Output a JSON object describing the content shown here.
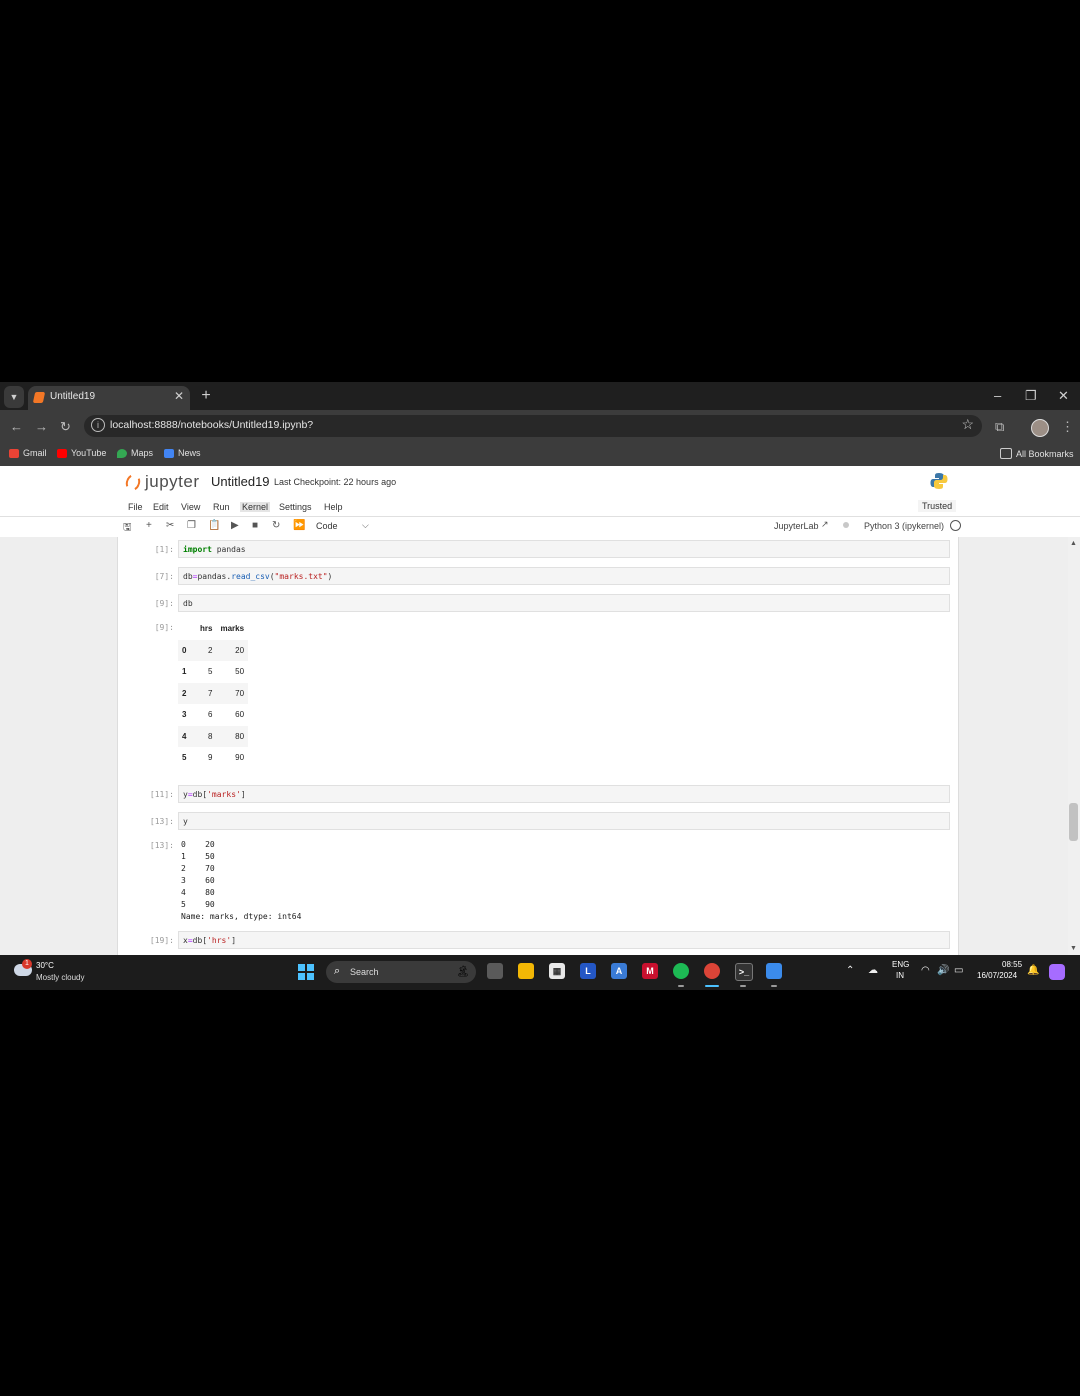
{
  "browser": {
    "tab_title": "Untitled19",
    "url": "localhost:8888/notebooks/Untitled19.ipynb?",
    "bookmarks": [
      "Gmail",
      "YouTube",
      "Maps",
      "News"
    ],
    "all_bookmarks": "All Bookmarks"
  },
  "jupyter": {
    "logo_text": "jupyter",
    "notebook_name": "Untitled19",
    "checkpoint": "Last Checkpoint: 22 hours ago",
    "menu": [
      "File",
      "Edit",
      "View",
      "Run",
      "Kernel",
      "Settings",
      "Help"
    ],
    "trusted": "Trusted",
    "cell_type": "Code",
    "jupyterlab_link": "JupyterLab",
    "kernel": "Python 3 (ipykernel)"
  },
  "cells": [
    {
      "prompt": "[1]:",
      "code": "import pandas"
    },
    {
      "prompt": "[7]:",
      "code": "db=pandas.read_csv(\"marks.txt\")"
    },
    {
      "prompt": "[9]:",
      "code": "db"
    },
    {
      "prompt": "[9]:",
      "output": "dataframe"
    },
    {
      "prompt": "[11]:",
      "code": "y=db['marks']"
    },
    {
      "prompt": "[13]:",
      "code": "y"
    },
    {
      "prompt": "[13]:",
      "output": "series"
    },
    {
      "prompt": "[19]:",
      "code": "x=db['hrs']"
    }
  ],
  "dataframe": {
    "columns": [
      "hrs",
      "marks"
    ],
    "rows": [
      {
        "index": "0",
        "hrs": "2",
        "marks": "20"
      },
      {
        "index": "1",
        "hrs": "5",
        "marks": "50"
      },
      {
        "index": "2",
        "hrs": "7",
        "marks": "70"
      },
      {
        "index": "3",
        "hrs": "6",
        "marks": "60"
      },
      {
        "index": "4",
        "hrs": "8",
        "marks": "80"
      },
      {
        "index": "5",
        "hrs": "9",
        "marks": "90"
      }
    ]
  },
  "series_output": "0    20\n1    50\n2    70\n3    60\n4    80\n5    90\nName: marks, dtype: int64",
  "taskbar": {
    "temperature": "30°C",
    "condition": "Mostly cloudy",
    "weather_badge": "1",
    "search": "Search",
    "lang": "ENG",
    "region": "IN",
    "time": "08:55",
    "date": "16/07/2024"
  },
  "colors": {
    "jupyter_orange": "#f37726",
    "taskbar": "#1c1c1c",
    "chrome_dark": "#3c3c3c"
  }
}
